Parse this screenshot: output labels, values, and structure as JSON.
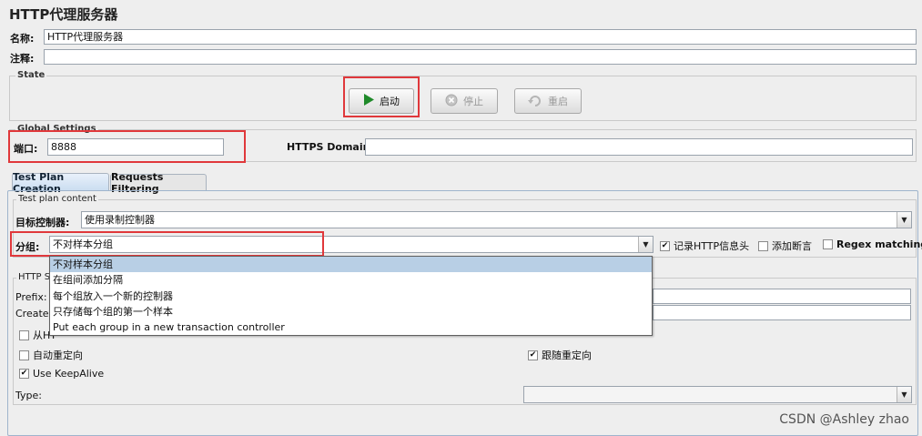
{
  "window": {
    "title": "HTTP代理服务器"
  },
  "name_row": {
    "label": "名称:",
    "value": "HTTP代理服务器"
  },
  "comment_row": {
    "label": "注释:",
    "value": ""
  },
  "state": {
    "legend": "State",
    "start_label": "启动",
    "stop_label": "停止",
    "restart_label": "重启"
  },
  "global_settings": {
    "legend": "Global Settings",
    "port_label": "端口:",
    "port_value": "8888",
    "https_label": "HTTPS Domains:",
    "https_value": ""
  },
  "tabs": [
    {
      "label": "Test Plan Creation",
      "active": true
    },
    {
      "label": "Requests Filtering",
      "active": false
    }
  ],
  "test_plan": {
    "legend": "Test plan content",
    "target_label": "目标控制器:",
    "target_value": "使用录制控制器",
    "group_label": "分组:",
    "group_value": "不对样本分组",
    "group_options": [
      "不对样本分组",
      "在组间添加分隔",
      "每个组放入一个新的控制器",
      "只存储每个组的第一个样本",
      "Put each group in a new transaction controller"
    ],
    "record_headers_label": "记录HTTP信息头",
    "record_headers_checked": true,
    "add_assertions_label": "添加断言",
    "add_assertions_checked": false,
    "regex_label": "Regex matching",
    "regex_checked": false
  },
  "http_sampler": {
    "legend_prefix": "HTTP S",
    "prefix_label": "Prefix:",
    "prefix_value": "",
    "create_label_prefix": "Create n",
    "create_value": "",
    "from_html_partial": "从HT",
    "auto_redirect_label": "自动重定向",
    "auto_redirect_checked": false,
    "follow_redirect_label": "跟随重定向",
    "follow_redirect_checked": true,
    "keepalive_label": "Use KeepAlive",
    "keepalive_checked": true,
    "type_label": "Type:",
    "type_value": ""
  },
  "watermark": "CSDN @Ashley zhao",
  "colors": {
    "highlight_box": "#e0383b",
    "selection": "#b8cfe5",
    "start_icon": "#1f8a2a"
  }
}
